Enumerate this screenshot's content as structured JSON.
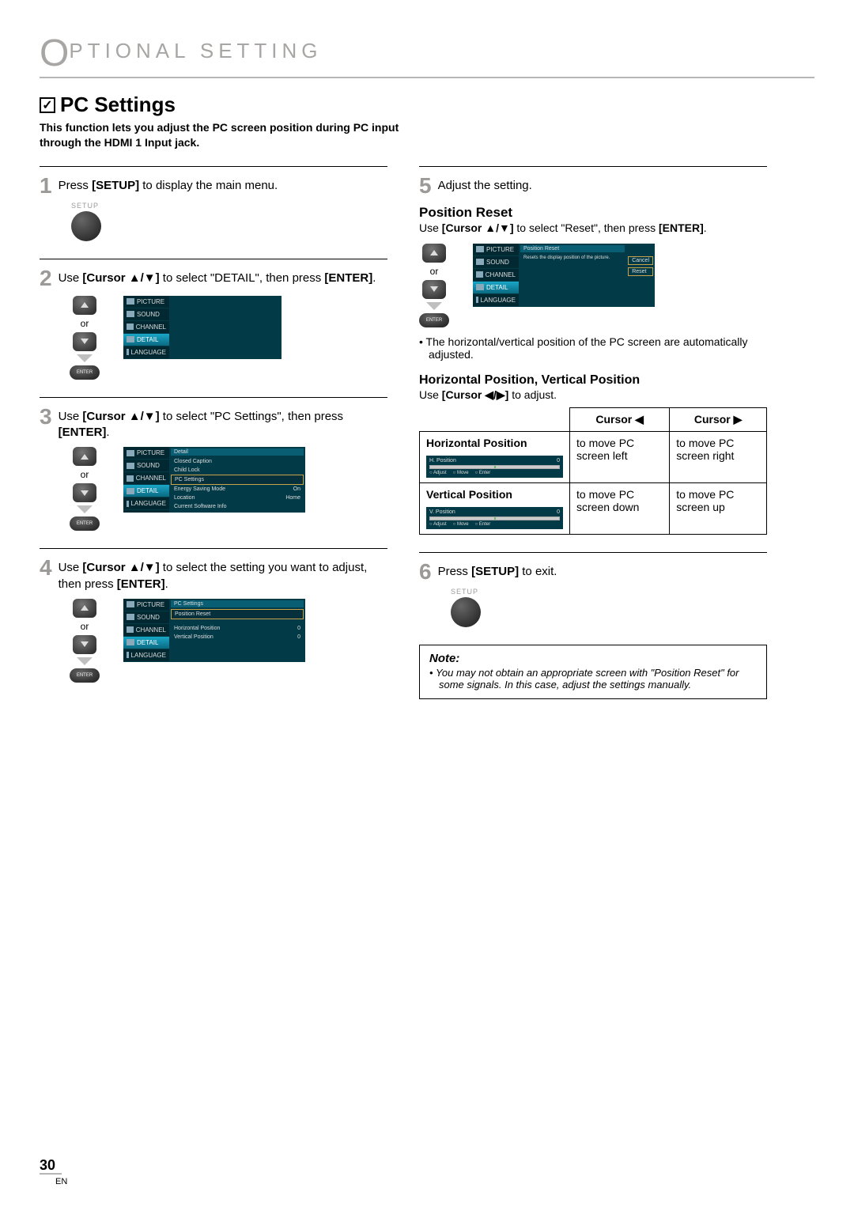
{
  "header": {
    "letter": "O",
    "rest": "PTIONAL   SETTING"
  },
  "section": {
    "check": "✓",
    "title": "PC Settings",
    "intro": "This function lets you adjust the PC screen position during PC input through the HDMI 1 Input jack."
  },
  "osd_menu": {
    "items": [
      "PICTURE",
      "SOUND",
      "CHANNEL",
      "DETAIL",
      "LANGUAGE"
    ]
  },
  "steps": {
    "s1": {
      "num": "1",
      "text_a": "Press ",
      "bold_a": "[SETUP]",
      "text_b": " to display the main menu.",
      "setup_label": "SETUP"
    },
    "s2": {
      "num": "2",
      "text_a": "Use ",
      "bold_a": "[Cursor ▲/▼]",
      "text_b": " to select \"DETAIL\", then press ",
      "bold_b": "[ENTER]",
      "text_c": ".",
      "or": "or",
      "enter_label": "ENTER"
    },
    "s3": {
      "num": "3",
      "text_a": "Use ",
      "bold_a": "[Cursor ▲/▼]",
      "text_b": " to select \"PC Settings\", then press ",
      "bold_b": "[ENTER]",
      "text_c": ".",
      "or": "or",
      "enter_label": "ENTER",
      "panel_title": "Detail",
      "rows": [
        {
          "l": "Closed Caption",
          "r": ""
        },
        {
          "l": "Child Lock",
          "r": ""
        },
        {
          "l": "PC Settings",
          "r": "",
          "sel": true
        },
        {
          "l": "Energy Saving Mode",
          "r": "On"
        },
        {
          "l": "Location",
          "r": "Home"
        },
        {
          "l": "Current Software Info",
          "r": ""
        }
      ]
    },
    "s4": {
      "num": "4",
      "text_a": "Use ",
      "bold_a": "[Cursor ▲/▼]",
      "text_b": " to select the setting you want to adjust, then press ",
      "bold_b": "[ENTER]",
      "text_c": ".",
      "or": "or",
      "enter_label": "ENTER",
      "panel_title": "PC Settings",
      "rows": [
        {
          "l": "Position Reset",
          "r": "",
          "sel": true
        },
        {
          "l": "Horizontal Position",
          "r": "0"
        },
        {
          "l": "Vertical Position",
          "r": "0"
        }
      ]
    },
    "s5": {
      "num": "5",
      "text": "Adjust the setting.",
      "pr_title": "Position Reset",
      "pr_text_a": "Use ",
      "pr_bold_a": "[Cursor ▲/▼]",
      "pr_text_b": " to select \"Reset\", then press ",
      "pr_bold_b": "[ENTER]",
      "pr_text_c": ".",
      "or": "or",
      "enter_label": "ENTER",
      "pr_panel_title": "Position Reset",
      "pr_msg": "Resets the display position of the picture.",
      "pr_btn1": "Cancel",
      "pr_btn2": "Reset",
      "pr_bullet": "The horizontal/vertical position of the PC screen are automatically adjusted.",
      "hv_title": "Horizontal Position, Vertical Position",
      "hv_text_a": "Use ",
      "hv_bold_a": "[Cursor ◀/▶]",
      "hv_text_b": " to adjust.",
      "table": {
        "h1": "Cursor ◀",
        "h2": "Cursor ▶",
        "r1label": "Horizontal Position",
        "r1_osd_title": "H. Position",
        "r1_osd_val": "0",
        "r1_adjust": "Adjust",
        "r1_move": "Move",
        "r1_enter": "Enter",
        "r1c1": "to move PC screen left",
        "r1c2": "to move PC screen right",
        "r2label": "Vertical Position",
        "r2_osd_title": "V. Position",
        "r2_osd_val": "0",
        "r2_adjust": "Adjust",
        "r2_move": "Move",
        "r2_enter": "Enter",
        "r2c1": "to move PC screen down",
        "r2c2": "to move PC screen up"
      }
    },
    "s6": {
      "num": "6",
      "text_a": "Press ",
      "bold_a": "[SETUP]",
      "text_b": " to exit.",
      "setup_label": "SETUP"
    }
  },
  "note": {
    "title": "Note:",
    "item": "You may not obtain an appropriate screen with \"Position Reset\" for some signals. In this case, adjust the settings manually."
  },
  "footer": {
    "page": "30",
    "lang": "EN"
  }
}
